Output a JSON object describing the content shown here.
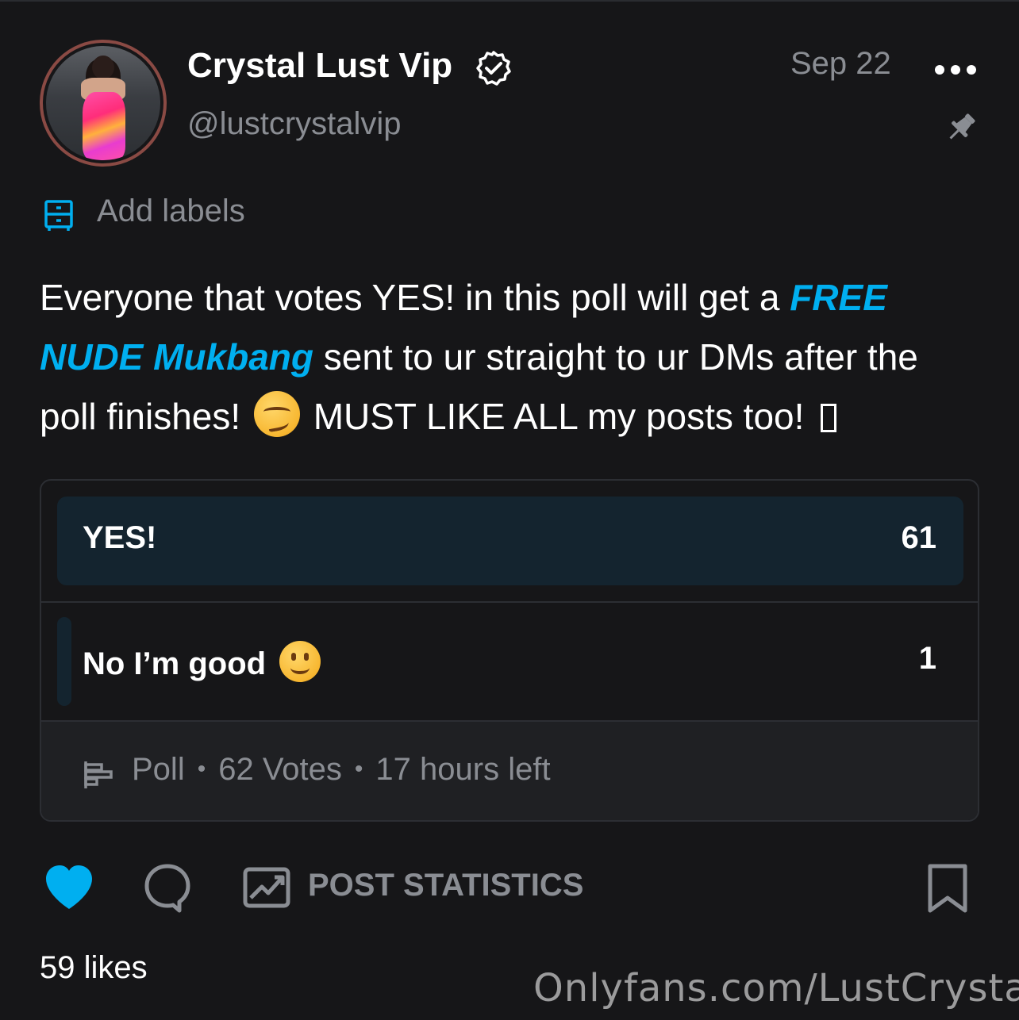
{
  "post": {
    "display_name": "Crystal Lust Vip",
    "handle": "@lustcrystalvip",
    "date": "Sep 22",
    "add_labels": "Add labels",
    "text": {
      "part1": "Everyone that votes YES! in this poll will get a ",
      "highlight": "FREE NUDE Mukbang",
      "part2": " sent to ur straight to ur DMs after the poll finishes! ",
      "part3": " MUST LIKE ALL my posts too! "
    },
    "emoji_1": "smirking-face",
    "emoji_2": "slightly-smiling-face"
  },
  "poll": {
    "options": [
      {
        "label": "YES!",
        "votes": "61",
        "share": 0.98
      },
      {
        "label": "No I’m good",
        "votes": "1",
        "share": 0.02
      }
    ],
    "type_label": "Poll",
    "votes_label": "62 Votes",
    "time_left": "17 hours left"
  },
  "actions": {
    "stats_label": "POST STATISTICS",
    "likes": "59 likes"
  },
  "watermark": "Onlyfans.com/LustCrystal",
  "icons": [
    "verified-icon",
    "more-icon",
    "pin-icon",
    "labels-icon",
    "poll-icon",
    "heart-icon",
    "comment-icon",
    "stats-icon",
    "bookmark-icon"
  ],
  "colors": {
    "background": "#161618",
    "accent": "#00aff0",
    "muted_text": "#8a8d93",
    "poll_fill": "#14242f",
    "avatar_ring": "#8a4a44"
  }
}
